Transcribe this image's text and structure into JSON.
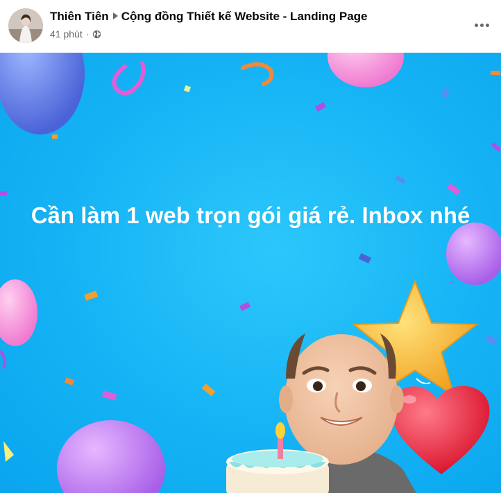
{
  "post": {
    "author": "Thiên Tiên",
    "group": "Cộng đồng Thiết kế Website - Landing Page",
    "time": "41 phút",
    "separator": "·",
    "privacy_icon": "globe-icon",
    "more_icon": "more-options-icon"
  },
  "banner": {
    "text": "Cần làm 1 web trọn gói giá rẻ. Inbox nhé",
    "background_color": "#1ab6f6",
    "decorations": [
      "balloon",
      "confetti",
      "star-balloon",
      "heart-balloon",
      "birthday-cake",
      "avatar-character"
    ]
  }
}
